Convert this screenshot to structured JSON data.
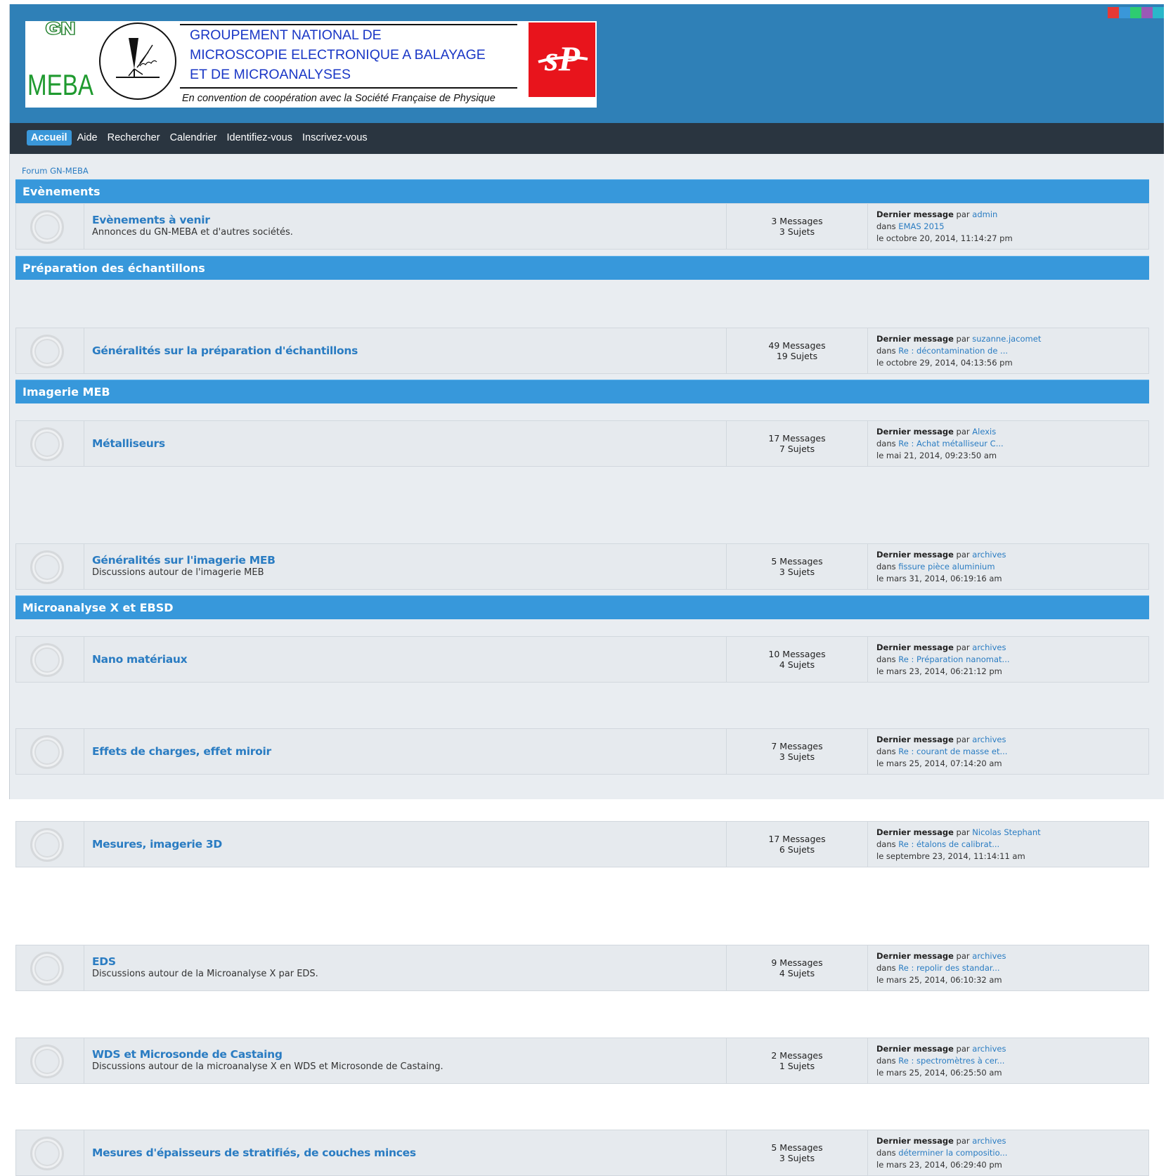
{
  "logo": {
    "gn": "GN",
    "meba": "MEBA",
    "lines": [
      "GROUPEMENT NATIONAL DE",
      "MICROSCOPIE ELECTRONIQUE A BALAYAGE",
      "ET DE MICROANALYSES"
    ],
    "subtitle": "En convention de coopération avec la Société Française de Physique",
    "sfp": "sP"
  },
  "theme_colors": [
    "#e53935",
    "#3a97d9",
    "#2ecc71",
    "#9b59b6",
    "#2ab7ca"
  ],
  "nav": [
    "Accueil",
    "Aide",
    "Rechercher",
    "Calendrier",
    "Identifiez-vous",
    "Inscrivez-vous"
  ],
  "breadcrumb": "Forum GN-MEBA",
  "labels": {
    "last_post": "Dernier message",
    "by": "par",
    "in": "dans"
  },
  "categories": [
    {
      "name": "Evènements",
      "boards": [
        {
          "title": "Evènements à venir",
          "desc": "Annonces du GN-MEBA et d'autres sociétés.",
          "messages": "3 Messages",
          "topics": "3 Sujets",
          "author": "admin",
          "topic": "EMAS 2015",
          "date": "le octobre 20, 2014, 11:14:27 pm"
        }
      ]
    },
    {
      "name": "Préparation des échantillons",
      "boards": [
        {
          "title": "Généralités sur la préparation d'échantillons",
          "desc": "",
          "messages": "49 Messages",
          "topics": "19 Sujets",
          "author": "suzanne.jacomet",
          "topic": "Re : décontamination de ...",
          "date": "le octobre 29, 2014, 04:13:56 pm"
        },
        {
          "title": "Métalliseurs",
          "desc": "",
          "messages": "17 Messages",
          "topics": "7 Sujets",
          "author": "Alexis",
          "topic": "Re : Achat métalliseur C...",
          "date": "le mai 21, 2014, 09:23:50 am"
        }
      ]
    },
    {
      "name": "Imagerie MEB",
      "boards": [
        {
          "title": "Généralités sur l'imagerie MEB",
          "desc": "Discussions autour de l'imagerie MEB",
          "messages": "5 Messages",
          "topics": "3 Sujets",
          "author": "archives",
          "topic": "fissure pièce aluminium",
          "date": "le mars 31, 2014, 06:19:16 am"
        },
        {
          "title": "Nano matériaux",
          "desc": "",
          "messages": "10 Messages",
          "topics": "4 Sujets",
          "author": "archives",
          "topic": "Re : Préparation nanomat...",
          "date": "le mars 23, 2014, 06:21:12 pm"
        },
        {
          "title": "Effets de charges, effet miroir",
          "desc": "",
          "messages": "7 Messages",
          "topics": "3 Sujets",
          "author": "archives",
          "topic": "Re : courant de masse et...",
          "date": "le mars 25, 2014, 07:14:20 am"
        },
        {
          "title": "Mesures, imagerie 3D",
          "desc": "",
          "messages": "17 Messages",
          "topics": "6 Sujets",
          "author": "Nicolas Stephant",
          "topic": "Re : étalons de calibrat...",
          "date": "le septembre 23, 2014, 11:14:11 am"
        }
      ]
    },
    {
      "name": "Microanalyse X et EBSD",
      "boards": [
        {
          "title": "EDS",
          "desc": "Discussions autour de la Microanalyse X par EDS.",
          "messages": "9 Messages",
          "topics": "4 Sujets",
          "author": "archives",
          "topic": "Re : repolir des standar...",
          "date": "le mars 25, 2014, 06:10:32 am"
        },
        {
          "title": "WDS et Microsonde de Castaing",
          "desc": "Discussions autour de la microanalyse X en WDS et Microsonde de Castaing.",
          "messages": "2 Messages",
          "topics": "1 Sujets",
          "author": "archives",
          "topic": "Re : spectromètres à cer...",
          "date": "le mars 25, 2014, 06:25:50 am"
        },
        {
          "title": "Mesures d'épaisseurs de stratifiés, de couches minces",
          "desc": "",
          "messages": "5 Messages",
          "topics": "3 Sujets",
          "author": "archives",
          "topic": "déterminer la compositio...",
          "date": "le mars 23, 2014, 06:29:40 pm"
        }
      ]
    }
  ]
}
